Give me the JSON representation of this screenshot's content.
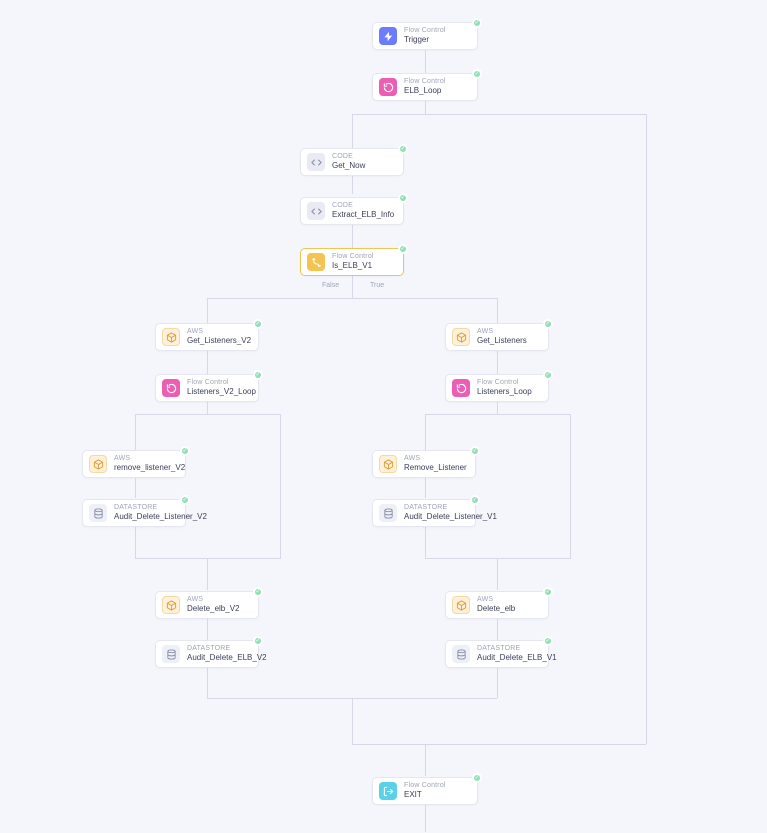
{
  "diagram": {
    "type": "workflow",
    "branchLabels": {
      "false": "False",
      "true": "True"
    }
  },
  "nodes": {
    "trigger": {
      "category": "Flow Control",
      "title": "Trigger"
    },
    "elb_loop": {
      "category": "Flow Control",
      "title": "ELB_Loop"
    },
    "get_now": {
      "category": "CODE",
      "title": "Get_Now"
    },
    "extract_elb_info": {
      "category": "CODE",
      "title": "Extract_ELB_Info"
    },
    "is_elb_v1": {
      "category": "Flow Control",
      "title": "Is_ELB_V1"
    },
    "get_listeners_v2": {
      "category": "AWS",
      "title": "Get_Listeners_V2"
    },
    "get_listeners": {
      "category": "AWS",
      "title": "Get_Listeners"
    },
    "listeners_v2_loop": {
      "category": "Flow Control",
      "title": "Listeners_V2_Loop"
    },
    "listeners_loop": {
      "category": "Flow Control",
      "title": "Listeners_Loop"
    },
    "remove_listener_v2": {
      "category": "AWS",
      "title": "remove_listener_V2"
    },
    "remove_listener": {
      "category": "AWS",
      "title": "Remove_Listener"
    },
    "audit_del_list_v2": {
      "category": "DATASTORE",
      "title": "Audit_Delete_Listener_V2"
    },
    "audit_del_list_v1": {
      "category": "DATASTORE",
      "title": "Audit_Delete_Listener_V1"
    },
    "delete_elb_v2": {
      "category": "AWS",
      "title": "Delete_elb_V2"
    },
    "delete_elb": {
      "category": "AWS",
      "title": "Delete_elb"
    },
    "audit_del_elb_v2": {
      "category": "DATASTORE",
      "title": "Audit_Delete_ELB_V2"
    },
    "audit_del_elb_v1": {
      "category": "DATASTORE",
      "title": "Audit_Delete_ELB_V1"
    },
    "exit": {
      "category": "Flow Control",
      "title": "EXIT"
    }
  }
}
